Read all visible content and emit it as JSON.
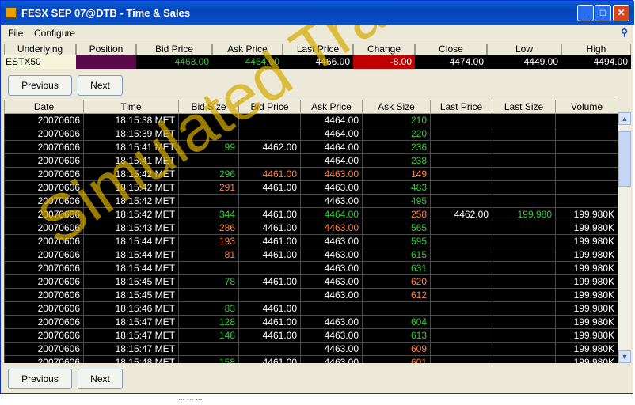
{
  "window": {
    "title": "FESX SEP 07@DTB - Time & Sales",
    "minimize": "_",
    "maximize": "□",
    "close": "✕"
  },
  "menu": {
    "file": "File",
    "configure": "Configure"
  },
  "quote": {
    "headers": [
      "Underlying",
      "Position",
      "Bid Price",
      "Ask Price",
      "Last Price",
      "Change",
      "Close",
      "Low",
      "High"
    ],
    "values": [
      "ESTX50",
      "",
      "4463.00",
      "4464.00",
      "4466.00",
      "-8.00",
      "4474.00",
      "4449.00",
      "4494.00"
    ]
  },
  "nav": {
    "previous": "Previous",
    "next": "Next"
  },
  "table": {
    "columns": [
      "Date",
      "Time",
      "Bid Size",
      "Bid Price",
      "Ask Price",
      "Ask Size",
      "Last Price",
      "Last Size",
      "Volume"
    ],
    "rows": [
      [
        "20070606",
        "18:15:38 MET",
        "",
        "",
        "4464.00",
        "210",
        "",
        "",
        ""
      ],
      [
        "20070606",
        "18:15:39 MET",
        "",
        "",
        "4464.00",
        "220",
        "",
        "",
        ""
      ],
      [
        "20070606",
        "18:15:41 MET",
        "99",
        "4462.00",
        "4464.00",
        "236",
        "",
        "",
        ""
      ],
      [
        "20070606",
        "18:15:41 MET",
        "",
        "",
        "4464.00",
        "238",
        "",
        "",
        ""
      ],
      [
        "20070606",
        "18:15:42 MET",
        "296",
        "4461.00",
        "4463.00",
        "149",
        "",
        "",
        ""
      ],
      [
        "20070606",
        "18:15:42 MET",
        "291",
        "4461.00",
        "4463.00",
        "483",
        "",
        "",
        ""
      ],
      [
        "20070606",
        "18:15:42 MET",
        "",
        "",
        "4463.00",
        "495",
        "",
        "",
        ""
      ],
      [
        "20070606",
        "18:15:42 MET",
        "344",
        "4461.00",
        "4464.00",
        "258",
        "4462.00",
        "199,980",
        "199.980K"
      ],
      [
        "20070606",
        "18:15:43 MET",
        "286",
        "4461.00",
        "4463.00",
        "565",
        "",
        "",
        "199.980K"
      ],
      [
        "20070606",
        "18:15:44 MET",
        "193",
        "4461.00",
        "4463.00",
        "595",
        "",
        "",
        "199.980K"
      ],
      [
        "20070606",
        "18:15:44 MET",
        "81",
        "4461.00",
        "4463.00",
        "615",
        "",
        "",
        "199.980K"
      ],
      [
        "20070606",
        "18:15:44 MET",
        "",
        "",
        "4463.00",
        "631",
        "",
        "",
        "199.980K"
      ],
      [
        "20070606",
        "18:15:45 MET",
        "78",
        "4461.00",
        "4463.00",
        "620",
        "",
        "",
        "199.980K"
      ],
      [
        "20070606",
        "18:15:45 MET",
        "",
        "",
        "4463.00",
        "612",
        "",
        "",
        "199.980K"
      ],
      [
        "20070606",
        "18:15:46 MET",
        "83",
        "4461.00",
        "",
        "",
        "",
        "",
        "199.980K"
      ],
      [
        "20070606",
        "18:15:47 MET",
        "128",
        "4461.00",
        "4463.00",
        "604",
        "",
        "",
        "199.980K"
      ],
      [
        "20070606",
        "18:15:47 MET",
        "148",
        "4461.00",
        "4463.00",
        "613",
        "",
        "",
        "199.980K"
      ],
      [
        "20070606",
        "18:15:47 MET",
        "",
        "",
        "4463.00",
        "609",
        "",
        "",
        "199.980K"
      ],
      [
        "20070606",
        "18:15:48 MET",
        "158",
        "4461.00",
        "4463.00",
        "601",
        "",
        "",
        "199.980K"
      ]
    ],
    "colors": [
      [
        "",
        "",
        "",
        "",
        "",
        "g",
        "",
        "",
        ""
      ],
      [
        "",
        "",
        "",
        "",
        "",
        "g",
        "",
        "",
        ""
      ],
      [
        "",
        "",
        "g",
        "",
        "",
        "g",
        "",
        "",
        ""
      ],
      [
        "",
        "",
        "",
        "",
        "",
        "g",
        "",
        "",
        ""
      ],
      [
        "",
        "",
        "g",
        "o",
        "o",
        "o",
        "",
        "",
        ""
      ],
      [
        "",
        "",
        "o",
        "",
        "",
        "g",
        "",
        "",
        ""
      ],
      [
        "",
        "",
        "",
        "",
        "",
        "g",
        "",
        "",
        ""
      ],
      [
        "",
        "",
        "g",
        "",
        "g",
        "o",
        "",
        "g",
        ""
      ],
      [
        "",
        "",
        "o",
        "",
        "o",
        "g",
        "",
        "",
        ""
      ],
      [
        "",
        "",
        "o",
        "",
        "",
        "g",
        "",
        "",
        ""
      ],
      [
        "",
        "",
        "o",
        "",
        "",
        "g",
        "",
        "",
        ""
      ],
      [
        "",
        "",
        "",
        "",
        "",
        "g",
        "",
        "",
        ""
      ],
      [
        "",
        "",
        "g",
        "",
        "",
        "o",
        "",
        "",
        ""
      ],
      [
        "",
        "",
        "",
        "",
        "",
        "o",
        "",
        "",
        ""
      ],
      [
        "",
        "",
        "g",
        "",
        "",
        "",
        "",
        "",
        ""
      ],
      [
        "",
        "",
        "g",
        "",
        "",
        "g",
        "",
        "",
        ""
      ],
      [
        "",
        "",
        "g",
        "",
        "",
        "g",
        "",
        "",
        ""
      ],
      [
        "",
        "",
        "",
        "",
        "",
        "o",
        "",
        "",
        ""
      ],
      [
        "",
        "",
        "g",
        "",
        "",
        "o",
        "",
        "",
        ""
      ]
    ]
  },
  "watermark": "Simulated Trading",
  "status_text": "... ... ...",
  "colors": {
    "title_bar": "#0a50cc",
    "position_fill": "#5a0a4a",
    "change_bg": "#c00000",
    "up": "#33cc33",
    "down": "#ff8040"
  }
}
